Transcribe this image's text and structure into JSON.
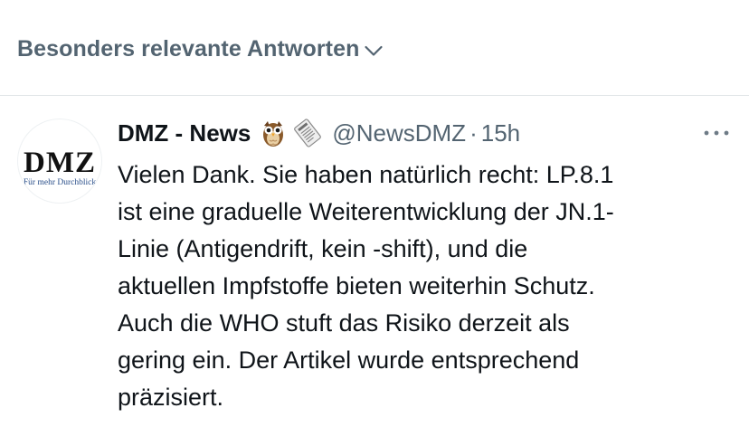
{
  "sort_bar": {
    "label": "Besonders relevante Antworten",
    "chevron_icon": "chevron-down-icon"
  },
  "tweet": {
    "author": {
      "display_name": "DMZ - News",
      "emojis": [
        "owl-emoji-icon",
        "newspaper-emoji-icon"
      ],
      "handle": "@NewsDMZ",
      "separator": "·",
      "time": "15h",
      "avatar": {
        "logo_text": "DMZ",
        "tagline": "Für mehr Durchblick",
        "tagline_color": "#2a4f8a"
      }
    },
    "more_icon": "more-horizontal-icon",
    "text_lines": [
      "Vielen Dank. Sie haben natürlich recht: LP.8.1",
      "ist eine graduelle Weiterentwicklung der JN.1-",
      "Linie (Antigendrift, kein -shift), und die",
      "aktuellen Impfstoffe bieten weiterhin Schutz.",
      "Auch die WHO stuft das Risiko derzeit als",
      "gering ein. Der Artikel wurde entsprechend",
      "präzisiert."
    ]
  },
  "colors": {
    "primary_text": "#0f1419",
    "secondary_text": "#536471",
    "divider": "#e1e5e8"
  }
}
